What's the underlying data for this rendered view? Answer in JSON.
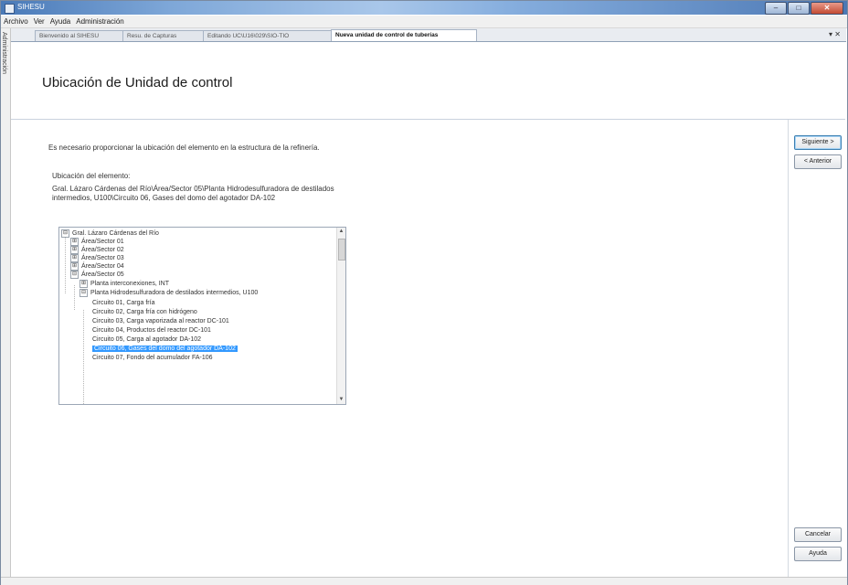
{
  "window": {
    "title": "SIHESU"
  },
  "menu": {
    "items": [
      "Archivo",
      "Ver",
      "Ayuda",
      "Administración"
    ]
  },
  "side_strip": {
    "label": "Administración"
  },
  "tabs": [
    {
      "label": "Bienvenido al SIHESU"
    },
    {
      "label": "Resu. de Capturas"
    },
    {
      "label": "Editando UC\\U16\\029\\SIO-TIO"
    },
    {
      "label": "Nueva unidad de control de tuberías"
    }
  ],
  "page": {
    "title": "Ubicación de Unidad de control"
  },
  "form": {
    "instruction": "Es necesario proporcionar la ubicación del elemento en la estructura de la refinería.",
    "location_label": "Ubicación del elemento:",
    "location_value": "Gral. Lázaro Cárdenas del Río\\Área/Sector 05\\Planta Hidrodesulfuradora de destilados intermedios, U100\\Circuito 06, Gases del domo del agotador DA-102"
  },
  "tree": {
    "nodes": [
      {
        "label": "Gral. Lázaro Cárdenas del Río",
        "expander": "⊟"
      },
      {
        "label": "Área/Sector 01",
        "expander": "⊞"
      },
      {
        "label": "Área/Sector 02",
        "expander": "⊞"
      },
      {
        "label": "Área/Sector 03",
        "expander": "⊞"
      },
      {
        "label": "Área/Sector 04",
        "expander": "⊞"
      },
      {
        "label": "Área/Sector 05",
        "expander": "⊟"
      },
      {
        "label": "Planta interconexiones, INT",
        "expander": "⊞"
      },
      {
        "label": "Planta Hidrodesulfuradora de destilados intermedios, U100",
        "expander": "⊟"
      },
      {
        "label": "Circuito 01, Carga fría",
        "expander": ""
      },
      {
        "label": "Circuito 02, Carga fría con hidrógeno",
        "expander": ""
      },
      {
        "label": "Circuito 03, Carga vaporizada al reactor DC-101",
        "expander": ""
      },
      {
        "label": "Circuito 04, Productos del reactor DC-101",
        "expander": ""
      },
      {
        "label": "Circuito 05, Carga al agotador DA-102",
        "expander": ""
      },
      {
        "label": "Circuito 06, Gases del domo del agotador DA-102",
        "expander": "",
        "selected": true
      },
      {
        "label": "Circuito 07, Fondo del acumulador FA-106",
        "expander": ""
      }
    ]
  },
  "buttons": {
    "next": "Siguiente >",
    "back": "< Anterior",
    "cancel": "Cancelar",
    "help": "Ayuda"
  },
  "colors": {
    "selection": "#3399ff",
    "titlebar": "#4a7ab8"
  }
}
